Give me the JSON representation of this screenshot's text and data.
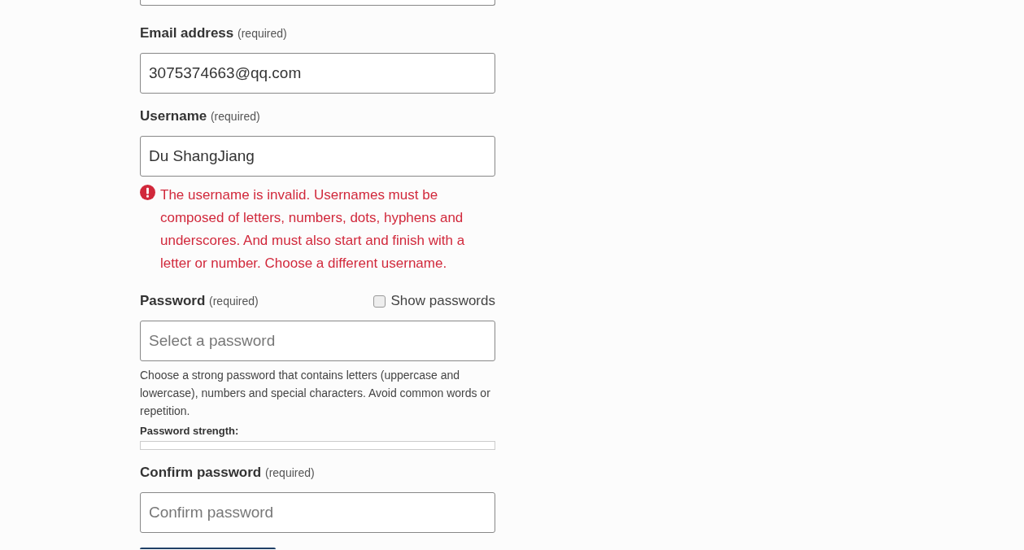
{
  "fields": [
    {
      "kind": "cut"
    },
    {
      "kind": "text",
      "label": "Email address",
      "note": "(required)",
      "value": "3075374663@qq.com"
    },
    {
      "kind": "text",
      "label": "Username",
      "note": "(required)",
      "value": "Du ShangJiang",
      "error": "The username is invalid. Usernames must be composed of letters, numbers, dots, hyphens and underscores. And must also start and finish with a letter or number. Choose a different username."
    },
    {
      "kind": "password",
      "label": "Password",
      "note": "(required)",
      "placeholder": "Select a password",
      "toggle": {
        "label": "Show passwords",
        "checked": false
      },
      "help": "Choose a strong password that contains letters (uppercase and lowercase), numbers and special characters. Avoid common words or repetition.",
      "strength": {
        "label": "Password strength:",
        "level": 0
      }
    },
    {
      "kind": "text",
      "label": "Confirm password",
      "note": "(required)",
      "placeholder": "Confirm password"
    },
    {
      "kind": "button"
    }
  ]
}
